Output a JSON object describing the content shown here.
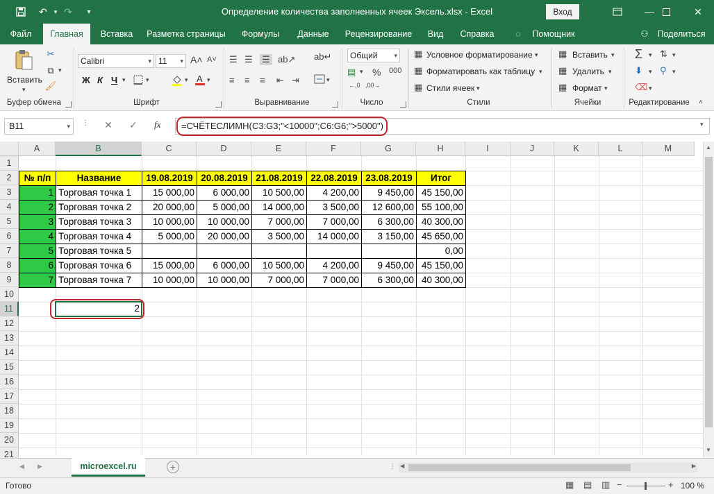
{
  "window": {
    "title": "Определение количества заполненных ячеек Эксель.xlsx  -  Excel",
    "signin_label": "Вход"
  },
  "tabs": [
    {
      "label": "Файл"
    },
    {
      "label": "Главная",
      "active": true
    },
    {
      "label": "Вставка"
    },
    {
      "label": "Разметка страницы"
    },
    {
      "label": "Формулы"
    },
    {
      "label": "Данные"
    },
    {
      "label": "Рецензирование"
    },
    {
      "label": "Вид"
    },
    {
      "label": "Справка"
    },
    {
      "label": "Помощник"
    }
  ],
  "share_label": "Поделиться",
  "ribbon": {
    "clipboard": {
      "paste": "Вставить",
      "group": "Буфер обмена"
    },
    "font": {
      "name": "Calibri",
      "size": "11",
      "bold": "Ж",
      "italic": "К",
      "underline": "Ч",
      "group": "Шрифт"
    },
    "alignment": {
      "group": "Выравнивание"
    },
    "number": {
      "format": "Общий",
      "group": "Число"
    },
    "styles": {
      "conditional": "Условное форматирование",
      "as_table": "Форматировать как таблицу",
      "cell_styles": "Стили ячеек",
      "group": "Стили"
    },
    "cells": {
      "insert": "Вставить",
      "delete": "Удалить",
      "format": "Формат",
      "group": "Ячейки"
    },
    "editing": {
      "group": "Редактирование"
    }
  },
  "formula_bar": {
    "name_box": "B11",
    "formula": "=СЧЁТЕСЛИМН(C3:G3;\"<10000\";C6:G6;\">5000\")"
  },
  "columns": [
    "A",
    "B",
    "C",
    "D",
    "E",
    "F",
    "G",
    "H",
    "I",
    "J",
    "K",
    "L",
    "M"
  ],
  "rows": [
    "1",
    "2",
    "3",
    "4",
    "5",
    "6",
    "7",
    "8",
    "9",
    "10",
    "11",
    "12",
    "13",
    "14",
    "15",
    "16",
    "17",
    "18",
    "19",
    "20",
    "21"
  ],
  "table": {
    "headers": [
      "№ п/п",
      "Название",
      "19.08.2019",
      "20.08.2019",
      "21.08.2019",
      "22.08.2019",
      "23.08.2019",
      "Итог"
    ],
    "rows": [
      [
        "1",
        "Торговая точка 1",
        "15 000,00",
        "6 000,00",
        "10 500,00",
        "4 200,00",
        "9 450,00",
        "45 150,00"
      ],
      [
        "2",
        "Торговая точка 2",
        "20 000,00",
        "5 000,00",
        "14 000,00",
        "3 500,00",
        "12 600,00",
        "55 100,00"
      ],
      [
        "3",
        "Торговая точка 3",
        "10 000,00",
        "10 000,00",
        "7 000,00",
        "7 000,00",
        "6 300,00",
        "40 300,00"
      ],
      [
        "4",
        "Торговая точка 4",
        "5 000,00",
        "20 000,00",
        "3 500,00",
        "14 000,00",
        "3 150,00",
        "45 650,00"
      ],
      [
        "5",
        "Торговая точка 5",
        "",
        "",
        "",
        "",
        "",
        "0,00"
      ],
      [
        "6",
        "Торговая точка 6",
        "15 000,00",
        "6 000,00",
        "10 500,00",
        "4 200,00",
        "9 450,00",
        "45 150,00"
      ],
      [
        "7",
        "Торговая точка 7",
        "10 000,00",
        "10 000,00",
        "7 000,00",
        "7 000,00",
        "6 300,00",
        "40 300,00"
      ]
    ]
  },
  "result_value": "2",
  "sheet_tab": "microexcel.ru",
  "status": {
    "ready": "Готово",
    "zoom": "100 %"
  },
  "colors": {
    "accent": "#217346",
    "header_fill": "#ffff00",
    "number_fill": "#2fc946",
    "highlight_ring": "#c0282d"
  }
}
